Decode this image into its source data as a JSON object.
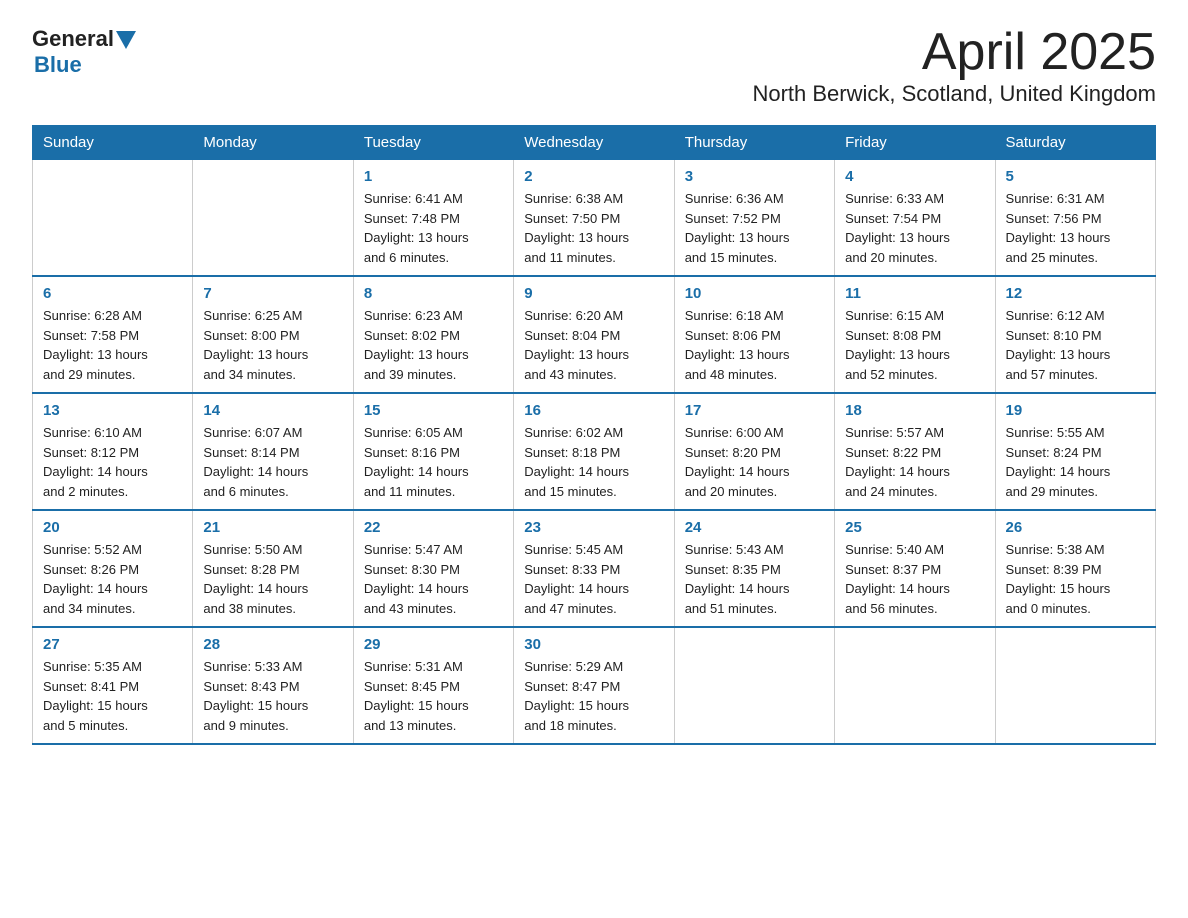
{
  "logo": {
    "general": "General",
    "blue": "Blue"
  },
  "title": "April 2025",
  "subtitle": "North Berwick, Scotland, United Kingdom",
  "weekdays": [
    "Sunday",
    "Monday",
    "Tuesday",
    "Wednesday",
    "Thursday",
    "Friday",
    "Saturday"
  ],
  "weeks": [
    [
      {
        "day": "",
        "info": ""
      },
      {
        "day": "",
        "info": ""
      },
      {
        "day": "1",
        "info": "Sunrise: 6:41 AM\nSunset: 7:48 PM\nDaylight: 13 hours\nand 6 minutes."
      },
      {
        "day": "2",
        "info": "Sunrise: 6:38 AM\nSunset: 7:50 PM\nDaylight: 13 hours\nand 11 minutes."
      },
      {
        "day": "3",
        "info": "Sunrise: 6:36 AM\nSunset: 7:52 PM\nDaylight: 13 hours\nand 15 minutes."
      },
      {
        "day": "4",
        "info": "Sunrise: 6:33 AM\nSunset: 7:54 PM\nDaylight: 13 hours\nand 20 minutes."
      },
      {
        "day": "5",
        "info": "Sunrise: 6:31 AM\nSunset: 7:56 PM\nDaylight: 13 hours\nand 25 minutes."
      }
    ],
    [
      {
        "day": "6",
        "info": "Sunrise: 6:28 AM\nSunset: 7:58 PM\nDaylight: 13 hours\nand 29 minutes."
      },
      {
        "day": "7",
        "info": "Sunrise: 6:25 AM\nSunset: 8:00 PM\nDaylight: 13 hours\nand 34 minutes."
      },
      {
        "day": "8",
        "info": "Sunrise: 6:23 AM\nSunset: 8:02 PM\nDaylight: 13 hours\nand 39 minutes."
      },
      {
        "day": "9",
        "info": "Sunrise: 6:20 AM\nSunset: 8:04 PM\nDaylight: 13 hours\nand 43 minutes."
      },
      {
        "day": "10",
        "info": "Sunrise: 6:18 AM\nSunset: 8:06 PM\nDaylight: 13 hours\nand 48 minutes."
      },
      {
        "day": "11",
        "info": "Sunrise: 6:15 AM\nSunset: 8:08 PM\nDaylight: 13 hours\nand 52 minutes."
      },
      {
        "day": "12",
        "info": "Sunrise: 6:12 AM\nSunset: 8:10 PM\nDaylight: 13 hours\nand 57 minutes."
      }
    ],
    [
      {
        "day": "13",
        "info": "Sunrise: 6:10 AM\nSunset: 8:12 PM\nDaylight: 14 hours\nand 2 minutes."
      },
      {
        "day": "14",
        "info": "Sunrise: 6:07 AM\nSunset: 8:14 PM\nDaylight: 14 hours\nand 6 minutes."
      },
      {
        "day": "15",
        "info": "Sunrise: 6:05 AM\nSunset: 8:16 PM\nDaylight: 14 hours\nand 11 minutes."
      },
      {
        "day": "16",
        "info": "Sunrise: 6:02 AM\nSunset: 8:18 PM\nDaylight: 14 hours\nand 15 minutes."
      },
      {
        "day": "17",
        "info": "Sunrise: 6:00 AM\nSunset: 8:20 PM\nDaylight: 14 hours\nand 20 minutes."
      },
      {
        "day": "18",
        "info": "Sunrise: 5:57 AM\nSunset: 8:22 PM\nDaylight: 14 hours\nand 24 minutes."
      },
      {
        "day": "19",
        "info": "Sunrise: 5:55 AM\nSunset: 8:24 PM\nDaylight: 14 hours\nand 29 minutes."
      }
    ],
    [
      {
        "day": "20",
        "info": "Sunrise: 5:52 AM\nSunset: 8:26 PM\nDaylight: 14 hours\nand 34 minutes."
      },
      {
        "day": "21",
        "info": "Sunrise: 5:50 AM\nSunset: 8:28 PM\nDaylight: 14 hours\nand 38 minutes."
      },
      {
        "day": "22",
        "info": "Sunrise: 5:47 AM\nSunset: 8:30 PM\nDaylight: 14 hours\nand 43 minutes."
      },
      {
        "day": "23",
        "info": "Sunrise: 5:45 AM\nSunset: 8:33 PM\nDaylight: 14 hours\nand 47 minutes."
      },
      {
        "day": "24",
        "info": "Sunrise: 5:43 AM\nSunset: 8:35 PM\nDaylight: 14 hours\nand 51 minutes."
      },
      {
        "day": "25",
        "info": "Sunrise: 5:40 AM\nSunset: 8:37 PM\nDaylight: 14 hours\nand 56 minutes."
      },
      {
        "day": "26",
        "info": "Sunrise: 5:38 AM\nSunset: 8:39 PM\nDaylight: 15 hours\nand 0 minutes."
      }
    ],
    [
      {
        "day": "27",
        "info": "Sunrise: 5:35 AM\nSunset: 8:41 PM\nDaylight: 15 hours\nand 5 minutes."
      },
      {
        "day": "28",
        "info": "Sunrise: 5:33 AM\nSunset: 8:43 PM\nDaylight: 15 hours\nand 9 minutes."
      },
      {
        "day": "29",
        "info": "Sunrise: 5:31 AM\nSunset: 8:45 PM\nDaylight: 15 hours\nand 13 minutes."
      },
      {
        "day": "30",
        "info": "Sunrise: 5:29 AM\nSunset: 8:47 PM\nDaylight: 15 hours\nand 18 minutes."
      },
      {
        "day": "",
        "info": ""
      },
      {
        "day": "",
        "info": ""
      },
      {
        "day": "",
        "info": ""
      }
    ]
  ]
}
